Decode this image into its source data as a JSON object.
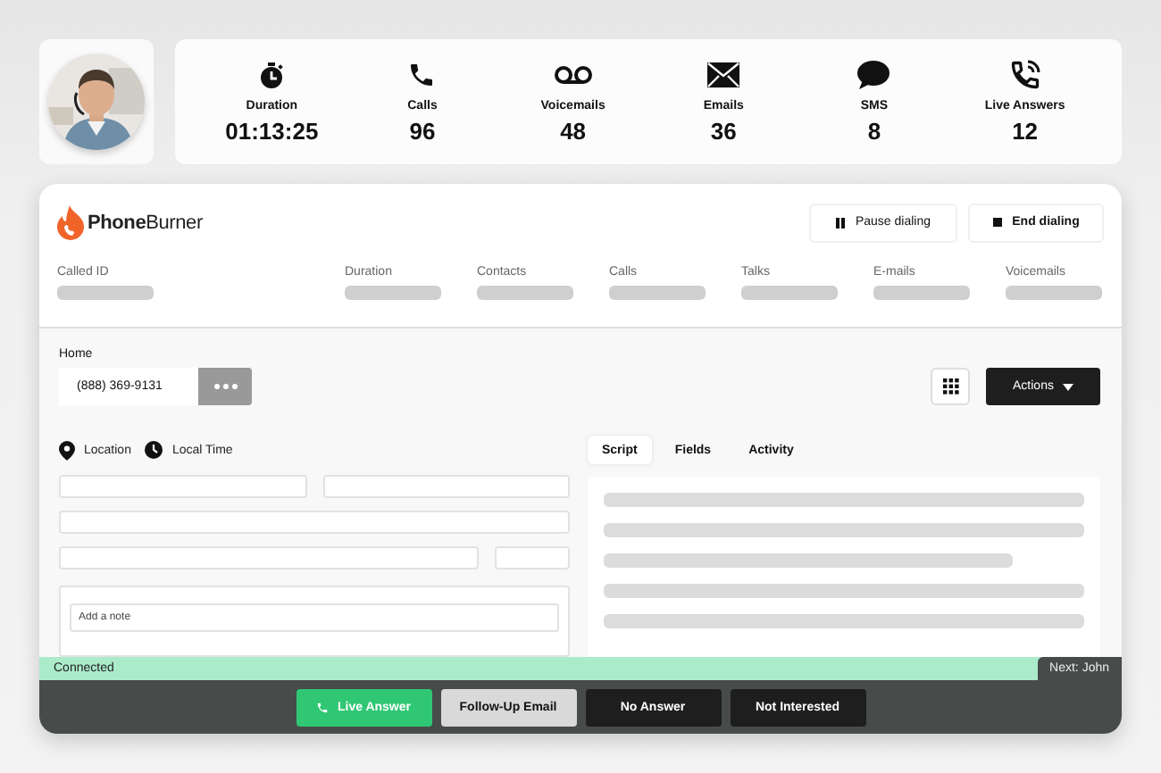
{
  "stats": [
    {
      "label": "Duration",
      "value": "01:13:25"
    },
    {
      "label": "Calls",
      "value": "96"
    },
    {
      "label": "Voicemails",
      "value": "48"
    },
    {
      "label": "Emails",
      "value": "36"
    },
    {
      "label": "SMS",
      "value": "8"
    },
    {
      "label": "Live Answers",
      "value": "12"
    }
  ],
  "logo": "**Phone**Burner",
  "header_buttons": [
    {
      "label": "Pause dialing",
      "kind": "pause"
    },
    {
      "label": "End dialing",
      "kind": "stop"
    }
  ],
  "summary_columns": [
    "Called ID",
    "Duration",
    "Contacts",
    "Calls",
    "Talks",
    "E-mails",
    "Voicemails"
  ],
  "phone": {
    "label": "Home",
    "value": "(888) 369-9131"
  },
  "actions_button": "Actions",
  "info": [
    {
      "label": "Location",
      "kind": "location"
    },
    {
      "label": "Local Time",
      "kind": "time"
    }
  ],
  "note": {
    "placeholder": "Add a note"
  },
  "tabs": [
    {
      "label": "Script",
      "selected": true
    },
    {
      "label": "Fields",
      "selected": false
    },
    {
      "label": "Activity",
      "selected": false
    }
  ],
  "status": {
    "text": "Connected",
    "next": "Next: John"
  },
  "dispositions": [
    {
      "label": "Live Answer",
      "kind": "live"
    },
    {
      "label": "Follow-Up Email",
      "kind": "light"
    },
    {
      "label": "No Answer",
      "kind": "dark"
    },
    {
      "label": "Not Interested",
      "kind": "dark"
    }
  ]
}
